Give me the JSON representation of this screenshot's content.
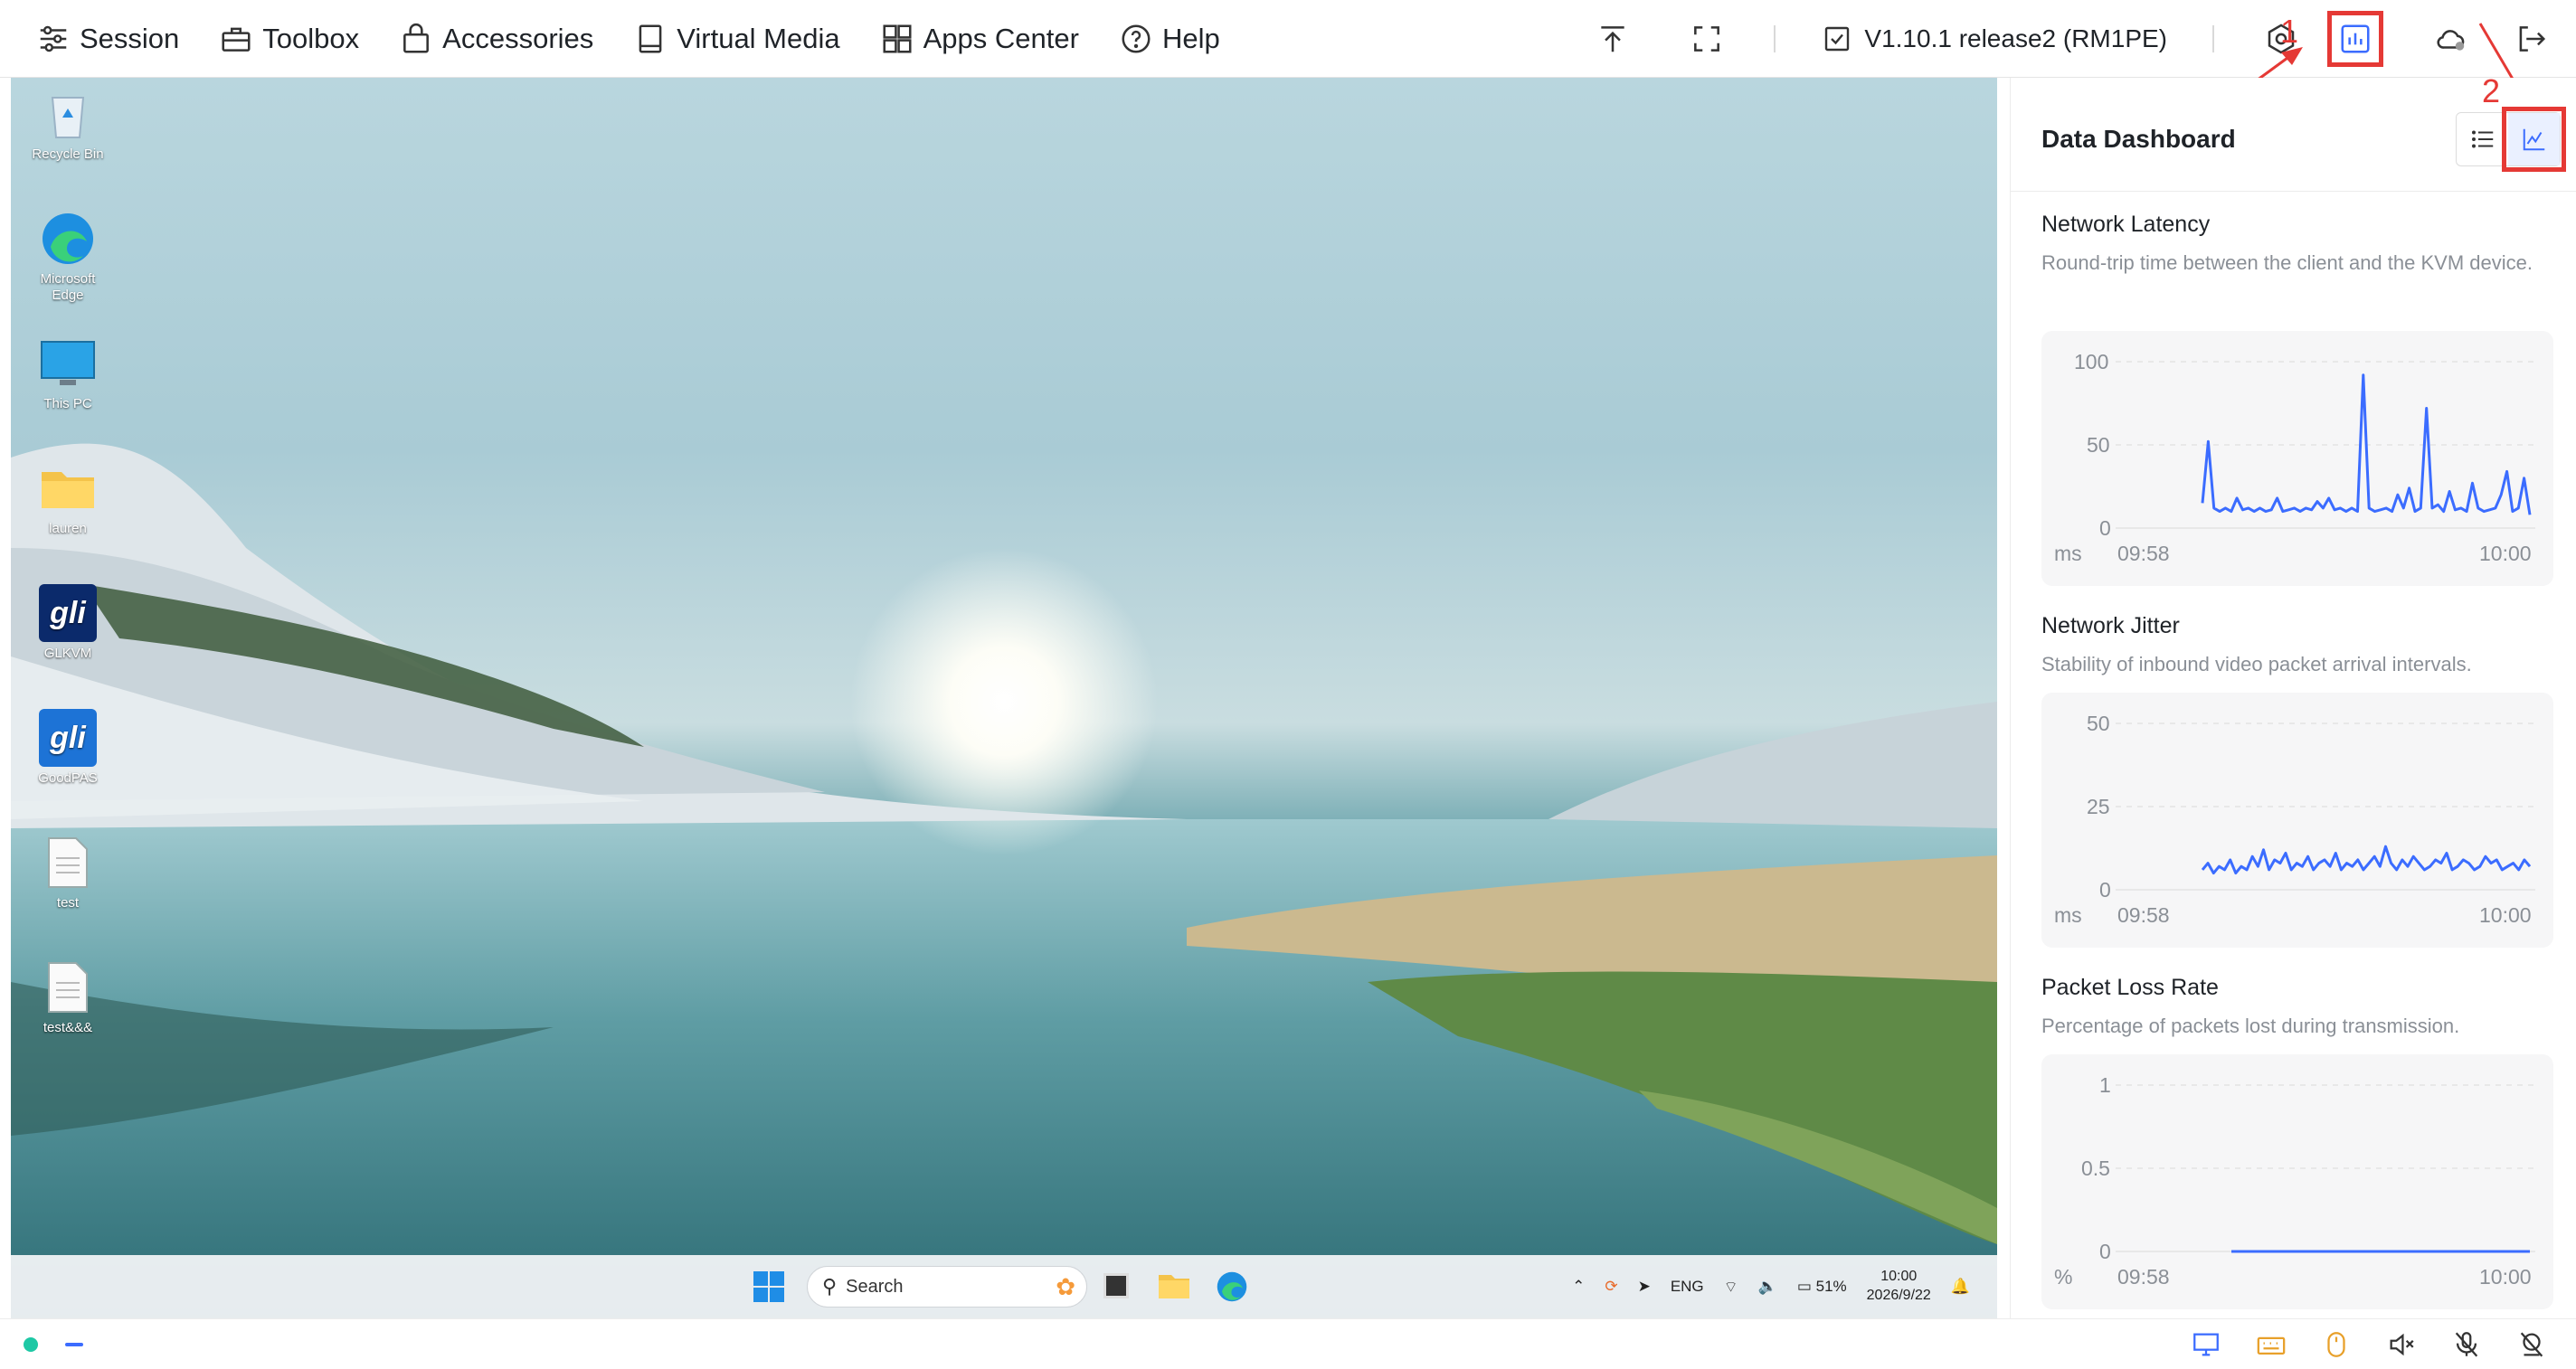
{
  "topbar": {
    "menu": [
      {
        "label": "Session",
        "icon": "sliders-icon"
      },
      {
        "label": "Toolbox",
        "icon": "toolbox-icon"
      },
      {
        "label": "Accessories",
        "icon": "bag-icon"
      },
      {
        "label": "Virtual Media",
        "icon": "drive-icon"
      },
      {
        "label": "Apps Center",
        "icon": "apps-icon"
      },
      {
        "label": "Help",
        "icon": "help-icon"
      }
    ],
    "version": "V1.10.1 release2 (RM1PE)",
    "annotation_1": "1",
    "annotation_2": "2",
    "highlight_color": "#e53935"
  },
  "desktop": {
    "icons": [
      "Recycle Bin",
      "Microsoft Edge",
      "This PC",
      "lauren",
      "GLKVM",
      "GoodPAS",
      "test",
      "test&&&"
    ],
    "taskbar": {
      "search_placeholder": "Search",
      "language": "ENG",
      "battery": "51%",
      "time": "10:00",
      "date": "2026/9/22"
    }
  },
  "panel": {
    "title": "Data Dashboard",
    "accent": "#3b6cff",
    "metrics": [
      {
        "title": "Network Latency",
        "description": "Round-trip time between the client and the KVM device.",
        "unit": "ms",
        "y_ticks": [
          "100",
          "50",
          "0"
        ],
        "x_start": "09:58",
        "x_end": "10:00"
      },
      {
        "title": "Network Jitter",
        "description": "Stability of inbound video packet arrival intervals.",
        "unit": "ms",
        "y_ticks": [
          "50",
          "25",
          "0"
        ],
        "x_start": "09:58",
        "x_end": "10:00"
      },
      {
        "title": "Packet Loss Rate",
        "description": "Percentage of packets lost during transmission.",
        "unit": "%",
        "y_ticks": [
          "1",
          "0.5",
          "0"
        ],
        "x_start": "09:58",
        "x_end": "10:00"
      }
    ]
  },
  "chart_data": [
    {
      "type": "line",
      "ylim": [
        0,
        100
      ],
      "values": [
        15,
        52,
        12,
        10,
        12,
        10,
        18,
        11,
        12,
        10,
        12,
        10,
        11,
        18,
        10,
        11,
        12,
        10,
        12,
        11,
        16,
        12,
        18,
        11,
        12,
        10,
        12,
        10,
        92,
        12,
        10,
        11,
        12,
        10,
        20,
        12,
        24,
        10,
        12,
        72,
        12,
        14,
        10,
        22,
        11,
        12,
        10,
        27,
        12,
        10,
        11,
        12,
        20,
        34,
        10,
        12,
        30,
        8
      ]
    },
    {
      "type": "line",
      "ylim": [
        0,
        50
      ],
      "values": [
        6,
        8,
        5,
        7,
        6,
        9,
        5,
        7,
        6,
        10,
        7,
        12,
        6,
        9,
        8,
        11,
        6,
        8,
        7,
        10,
        6,
        8,
        9,
        7,
        11,
        6,
        8,
        7,
        9,
        6,
        8,
        10,
        7,
        13,
        8,
        6,
        9,
        7,
        10,
        8,
        6,
        7,
        9,
        8,
        11,
        6,
        7,
        9,
        8,
        6,
        7,
        10,
        8,
        9,
        6,
        7,
        8,
        6,
        9,
        7
      ]
    },
    {
      "type": "line",
      "ylim": [
        0,
        1
      ],
      "values": [
        0,
        0,
        0,
        0,
        0,
        0,
        0,
        0,
        0,
        0,
        0
      ]
    }
  ]
}
